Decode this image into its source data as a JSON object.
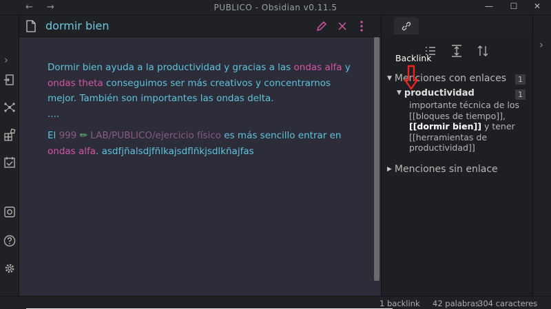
{
  "window": {
    "title": "PUBLICO - Obsidian v0.11.5",
    "back_label": "←",
    "forward_label": "→",
    "minimize_label": "—",
    "maximize_label": "☐",
    "close_label": "✕"
  },
  "ribbon": {
    "expand_label": "›",
    "icons": [
      "open-file-icon",
      "graph-icon",
      "templates-icon",
      "daily-note-icon",
      "vault-icon",
      "help-icon",
      "settings-icon"
    ]
  },
  "editor": {
    "file_title": "dormir bien",
    "paragraph1": {
      "t1": "Dormir bien ayuda a la productividad y gracias a las ",
      "link1": "ondas alfa",
      "t2": " y ",
      "link2": "ondas theta",
      "t3": " conseguimos ser más creativos y concentrarnos mejor. También son importantes las ondas delta.",
      "ellipsis": "...."
    },
    "paragraph2": {
      "t1": "El ",
      "num": "999",
      "path": "LAB/PUBLICO/ejercicio físico",
      "t2": " es más sencillo entrar en ",
      "link1": "ondas alfa",
      "t3": ". asdfjñalsdjfñlkajsdflñkjsdlkñajfas"
    }
  },
  "backlinks": {
    "annotation": "Backlink",
    "linked_section": "Menciones con enlaces",
    "linked_count": "1",
    "item_title": "productividad",
    "item_count": "1",
    "snippet_pre": "importante técnica de los [[bloques de tiempo]], ",
    "snippet_bold": "[[dormir bien]]",
    "snippet_post": " y tener [[herramientas de productividad]]",
    "unlinked_section": "Menciones sin enlace"
  },
  "status": {
    "backlinks": "1 backlink",
    "words": "42 palabras",
    "chars": "304 caracteres"
  },
  "colors": {
    "link": "#d654a8",
    "text": "#5fc3df",
    "accent_red": "#e8261f"
  }
}
